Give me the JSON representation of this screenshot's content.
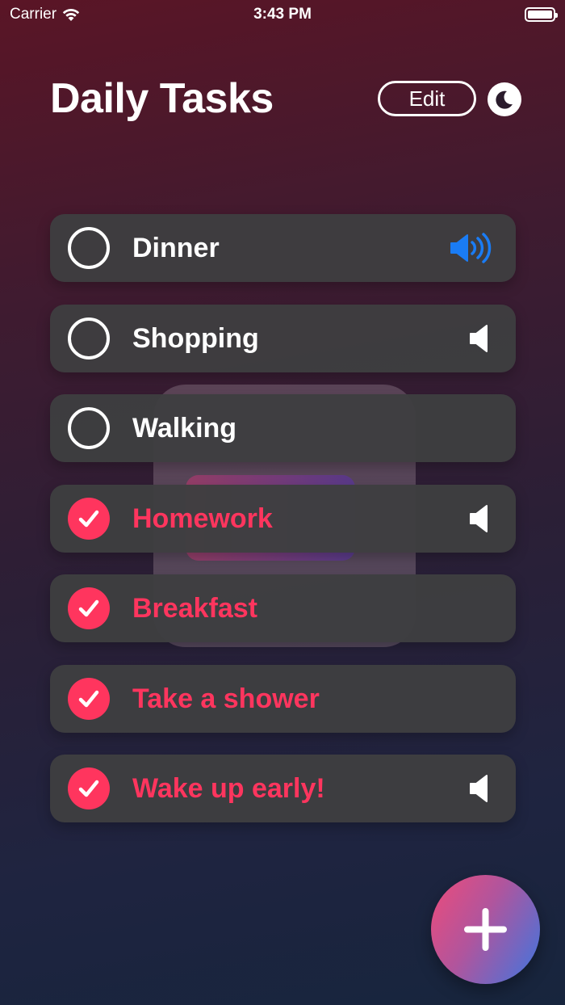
{
  "status_bar": {
    "carrier": "Carrier",
    "time": "3:43 PM"
  },
  "header": {
    "title": "Daily Tasks",
    "edit_label": "Edit"
  },
  "icons": {
    "theme": "moon-icon",
    "add": "plus-icon",
    "speaker_active": "speaker-wave-icon",
    "speaker": "speaker-icon"
  },
  "colors": {
    "accent": "#ff355e",
    "speaker_active": "#1a7cf5"
  },
  "tasks": [
    {
      "label": "Dinner",
      "done": false,
      "speaker": "active"
    },
    {
      "label": "Shopping",
      "done": false,
      "speaker": "muted"
    },
    {
      "label": "Walking",
      "done": false,
      "speaker": "none"
    },
    {
      "label": "Homework",
      "done": true,
      "speaker": "muted"
    },
    {
      "label": "Breakfast",
      "done": true,
      "speaker": "none"
    },
    {
      "label": "Take a shower",
      "done": true,
      "speaker": "none"
    },
    {
      "label": "Wake up early!",
      "done": true,
      "speaker": "muted"
    }
  ]
}
